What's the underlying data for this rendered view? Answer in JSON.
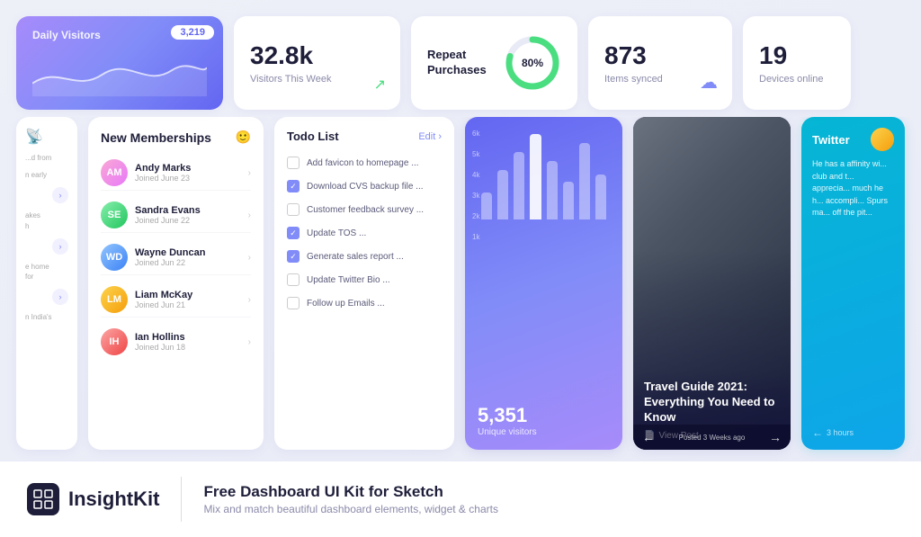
{
  "header": {
    "card_daily": {
      "label": "Daily Visitors",
      "badge": "3,219"
    },
    "card_visitors": {
      "big_num": "32.8k",
      "sub": "Visitors This Week"
    },
    "card_repeat": {
      "label": "Repeat\nPurchases",
      "percent": "80%"
    },
    "card_synced": {
      "big_num": "873",
      "sub": "Items synced"
    },
    "card_devices": {
      "big_num": "19",
      "sub": "Devices online"
    }
  },
  "memberships": {
    "title": "New Memberships",
    "members": [
      {
        "name": "Andy Marks",
        "joined": "Joined June 23",
        "initials": "AM"
      },
      {
        "name": "Sandra Evans",
        "joined": "Joined June 22",
        "initials": "SE"
      },
      {
        "name": "Wayne Duncan",
        "joined": "Joined Jun 22",
        "initials": "WD"
      },
      {
        "name": "Liam McKay",
        "joined": "Joined Jun 21",
        "initials": "LM"
      },
      {
        "name": "Ian Hollins",
        "joined": "Joined Jun 18",
        "initials": "IH"
      }
    ]
  },
  "todo": {
    "title": "Todo List",
    "edit_label": "Edit ›",
    "items": [
      {
        "text": "Add favicon to homepage ...",
        "checked": false
      },
      {
        "text": "Download CVS backup file ...",
        "checked": true
      },
      {
        "text": "Customer feedback survey ...",
        "checked": false
      },
      {
        "text": "Update TOS ...",
        "checked": true
      },
      {
        "text": "Generate sales report ...",
        "checked": true
      },
      {
        "text": "Update Twitter Bio ...",
        "checked": false
      },
      {
        "text": "Follow up Emails ...",
        "checked": false
      }
    ]
  },
  "chart": {
    "big_num": "5,351",
    "sub": "Unique visitors",
    "y_labels": [
      "6k",
      "5k",
      "4k",
      "3k",
      "2k",
      "1k"
    ],
    "bars": [
      30,
      55,
      75,
      95,
      65,
      40,
      85,
      50
    ]
  },
  "travel": {
    "title": "Travel Guide 2021: Everything You Need to Know",
    "view_post": "View Post",
    "posted": "Posted 3 Weeks ago"
  },
  "twitter": {
    "label": "Twitter",
    "quote": "He has a affinity wi... club and t... apprecia... much he h... accompli... Spurs ma... off the pit...",
    "time": "3 hours"
  },
  "branding": {
    "logo_name": "InsightKit",
    "title": "Free Dashboard UI Kit for Sketch",
    "sub": "Mix and match beautiful dashboard elements, widget & charts"
  }
}
